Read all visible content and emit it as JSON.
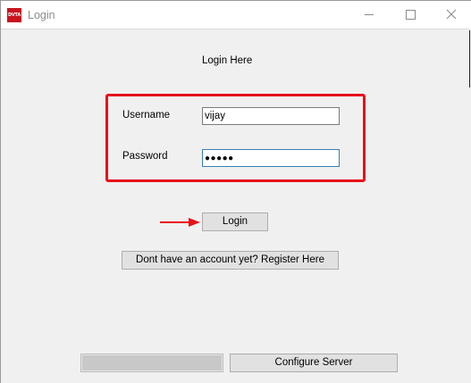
{
  "window": {
    "app_icon_text": "DVTA",
    "title": "Login"
  },
  "form": {
    "heading": "Login Here",
    "username_label": "Username",
    "username_value": "vijay",
    "password_label": "Password",
    "password_value": "●●●●●",
    "login_label": "Login",
    "register_label": "Dont have an account yet? Register Here"
  },
  "footer": {
    "progress": 1.0,
    "configure_label": "Configure Server"
  },
  "colors": {
    "highlight": "#e8111b",
    "app_icon": "#c8141e",
    "window_bg": "#f0f0f0",
    "button_bg": "#e1e1e1"
  },
  "icons": [
    "app-icon",
    "minimize-icon",
    "maximize-icon",
    "close-icon",
    "arrow-right-icon"
  ]
}
